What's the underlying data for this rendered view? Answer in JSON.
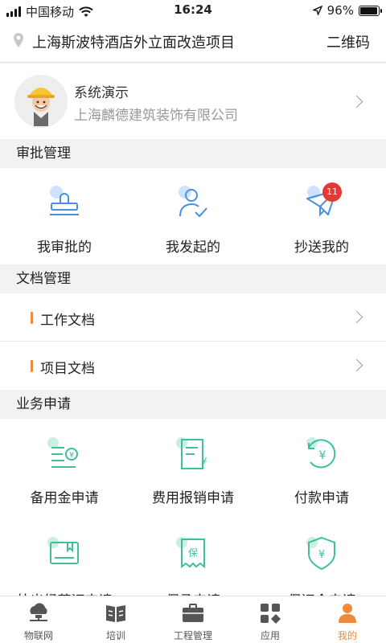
{
  "status_bar": {
    "carrier": "中国移动",
    "time": "16:24",
    "battery": "96%",
    "battery_level": 0.96
  },
  "header": {
    "project": "上海斯波特酒店外立面改造项目",
    "qr_label": "二维码"
  },
  "profile": {
    "name": "系统演示",
    "company": "上海麟德建筑装饰有限公司"
  },
  "approval": {
    "title": "审批管理",
    "items": [
      {
        "label": "我审批的",
        "icon": "stamp-icon"
      },
      {
        "label": "我发起的",
        "icon": "person-check-icon"
      },
      {
        "label": "抄送我的",
        "icon": "paper-plane-icon",
        "badge": "11"
      }
    ]
  },
  "docs": {
    "title": "文档管理",
    "items": [
      {
        "label": "工作文档"
      },
      {
        "label": "项目文档"
      }
    ]
  },
  "business": {
    "title": "业务申请",
    "items": [
      {
        "label": "备用金申请",
        "icon": "cash-icon"
      },
      {
        "label": "费用报销申请",
        "icon": "receipt-icon"
      },
      {
        "label": "付款申请",
        "icon": "payment-icon"
      },
      {
        "label": "外出经营证申请",
        "icon": "certificate-icon"
      },
      {
        "label": "保函申请",
        "icon": "guarantee-letter-icon"
      },
      {
        "label": "保证金申请",
        "icon": "deposit-shield-icon"
      }
    ]
  },
  "tabbar": {
    "items": [
      {
        "label": "物联网",
        "icon": "iot-icon"
      },
      {
        "label": "培训",
        "icon": "book-icon"
      },
      {
        "label": "工程管理",
        "icon": "briefcase-icon"
      },
      {
        "label": "应用",
        "icon": "apps-icon"
      },
      {
        "label": "我的",
        "icon": "user-icon",
        "active": true
      }
    ]
  },
  "colors": {
    "accent": "#f0893a",
    "approval_icon": "#4a90e2",
    "business_icon": "#3fbf9b",
    "badge": "#e53935"
  }
}
